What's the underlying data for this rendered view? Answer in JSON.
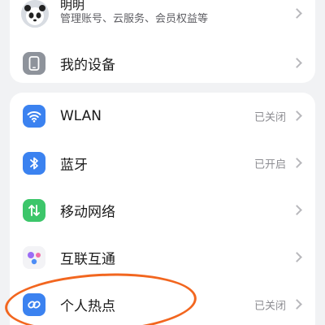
{
  "account": {
    "name": "明明",
    "subtitle": "管理账号、云服务、会员权益等"
  },
  "device_row": {
    "label": "我的设备",
    "icon": "phone-device-icon"
  },
  "settings": [
    {
      "id": "wlan",
      "label": "WLAN",
      "status": "已关闭",
      "icon": "wifi-icon",
      "icon_color": "#3b82f0"
    },
    {
      "id": "bluetooth",
      "label": "蓝牙",
      "status": "已开启",
      "icon": "bluetooth-icon",
      "icon_color": "#3b82f0"
    },
    {
      "id": "mobile",
      "label": "移动网络",
      "status": "",
      "icon": "mobile-data-icon",
      "icon_color": "#3cc66a"
    },
    {
      "id": "interconnect",
      "label": "互联互通",
      "status": "",
      "icon": "interconnect-icon",
      "icon_color": "#f3f3f6"
    },
    {
      "id": "hotspot",
      "label": "个人热点",
      "status": "已关闭",
      "icon": "hotspot-icon",
      "icon_color": "#3b82f0"
    }
  ],
  "annotation_color": "#f2661f"
}
